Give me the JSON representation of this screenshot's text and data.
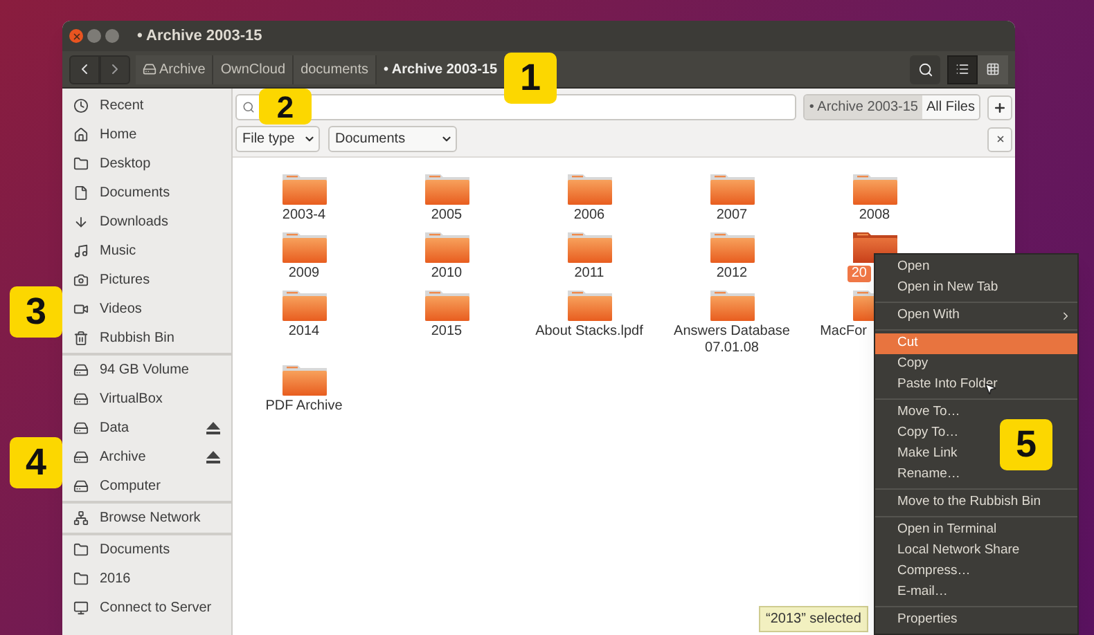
{
  "window": {
    "title": "• Archive 2003-15"
  },
  "breadcrumbs": [
    {
      "label": "Archive",
      "kind": "drive",
      "current": false
    },
    {
      "label": "OwnCloud",
      "kind": "plain",
      "current": false
    },
    {
      "label": "documents",
      "kind": "plain",
      "current": false
    },
    {
      "label": "• Archive 2003-15",
      "kind": "plain",
      "current": true
    }
  ],
  "view_buttons": [
    {
      "kind": "list",
      "selected": true
    },
    {
      "kind": "grid",
      "selected": false
    }
  ],
  "scope": [
    {
      "label": "• Archive 2003-15",
      "selected": true
    },
    {
      "label": "All Files",
      "selected": false
    }
  ],
  "filters": [
    {
      "label": "File type"
    },
    {
      "label": "Documents"
    }
  ],
  "sidebar": {
    "sections": [
      [
        {
          "label": "Recent",
          "kind": "recent",
          "eject": false
        },
        {
          "label": "Home",
          "kind": "home",
          "eject": false
        },
        {
          "label": "Desktop",
          "kind": "folder",
          "eject": false
        },
        {
          "label": "Documents",
          "kind": "document",
          "eject": false
        },
        {
          "label": "Downloads",
          "kind": "download",
          "eject": false
        },
        {
          "label": "Music",
          "kind": "music",
          "eject": false
        },
        {
          "label": "Pictures",
          "kind": "camera",
          "eject": false
        },
        {
          "label": "Videos",
          "kind": "video",
          "eject": false
        },
        {
          "label": "Rubbish Bin",
          "kind": "trash",
          "eject": false
        }
      ],
      [
        {
          "label": "94 GB Volume",
          "kind": "drive",
          "eject": false
        },
        {
          "label": "VirtualBox",
          "kind": "drive",
          "eject": false
        },
        {
          "label": "Data",
          "kind": "drive",
          "eject": true
        },
        {
          "label": "Archive",
          "kind": "computer",
          "eject": true
        },
        {
          "label": "Computer",
          "kind": "computer",
          "eject": false
        }
      ],
      [
        {
          "label": "Browse Network",
          "kind": "network",
          "eject": false
        }
      ],
      [
        {
          "label": "Documents",
          "kind": "folder",
          "eject": false
        },
        {
          "label": "2016",
          "kind": "folder",
          "eject": false
        },
        {
          "label": "Connect to Server",
          "kind": "server",
          "eject": false
        }
      ]
    ]
  },
  "files": [
    {
      "name": "2003-4",
      "selected": false,
      "kind": "whole"
    },
    {
      "name": "2005",
      "selected": false,
      "kind": "whole"
    },
    {
      "name": "2006",
      "selected": false,
      "kind": "whole"
    },
    {
      "name": "2007",
      "selected": false,
      "kind": "whole"
    },
    {
      "name": "2008",
      "selected": false,
      "kind": "whole"
    },
    {
      "name": "2009",
      "selected": false,
      "kind": "whole"
    },
    {
      "name": "2010",
      "selected": false,
      "kind": "whole"
    },
    {
      "name": "2011",
      "selected": false,
      "kind": "whole"
    },
    {
      "name": "2012",
      "selected": false,
      "kind": "whole"
    },
    {
      "name": "20",
      "selected": true,
      "kind": "clipped"
    },
    {
      "name": "2014",
      "selected": false,
      "kind": "whole"
    },
    {
      "name": "2015",
      "selected": false,
      "kind": "whole"
    },
    {
      "name": "About Stacks.lpdf",
      "selected": false,
      "kind": "whole"
    },
    {
      "name": "Answers Database 07.01.08",
      "selected": false,
      "kind": "whole"
    },
    {
      "name": "MacFor",
      "selected": false,
      "kind": "clipped"
    },
    {
      "name": "PDF Archive",
      "selected": false,
      "kind": "whole"
    }
  ],
  "status_bar": {
    "text": "“2013” selected"
  },
  "context_menu": {
    "groups": [
      [
        {
          "label": "Open",
          "selected": false,
          "submenu": false
        },
        {
          "label": "Open in New Tab",
          "selected": false,
          "submenu": false
        }
      ],
      [
        {
          "label": "Open With",
          "selected": false,
          "submenu": true
        }
      ],
      [
        {
          "label": "Cut",
          "selected": true,
          "submenu": false
        },
        {
          "label": "Copy",
          "selected": false,
          "submenu": false
        },
        {
          "label": "Paste Into Folder",
          "selected": false,
          "submenu": false
        }
      ],
      [
        {
          "label": "Move To…",
          "selected": false,
          "submenu": false
        },
        {
          "label": "Copy To…",
          "selected": false,
          "submenu": false
        },
        {
          "label": "Make Link",
          "selected": false,
          "submenu": false
        },
        {
          "label": "Rename…",
          "selected": false,
          "submenu": false
        }
      ],
      [
        {
          "label": "Move to the Rubbish Bin",
          "selected": false,
          "submenu": false
        }
      ],
      [
        {
          "label": "Open in Terminal",
          "selected": false,
          "submenu": false
        },
        {
          "label": "Local Network Share",
          "selected": false,
          "submenu": false
        },
        {
          "label": "Compress…",
          "selected": false,
          "submenu": false
        },
        {
          "label": "E-mail…",
          "selected": false,
          "submenu": false
        }
      ],
      [
        {
          "label": "Properties",
          "selected": false,
          "submenu": false
        }
      ]
    ]
  },
  "callouts": [
    {
      "label": "1"
    },
    {
      "label": "2"
    },
    {
      "label": "3"
    },
    {
      "label": "4"
    },
    {
      "label": "5"
    }
  ]
}
